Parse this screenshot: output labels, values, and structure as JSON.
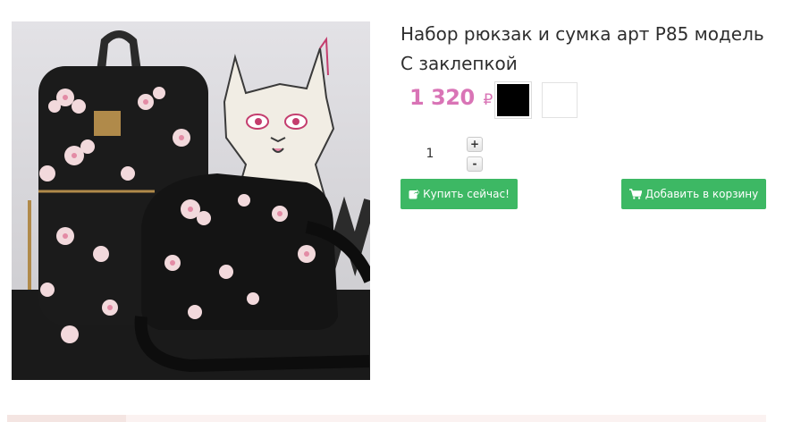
{
  "product": {
    "title": "Набор рюкзак и сумка арт Р85 модель С заклепкой",
    "image_alt": "Набор рюкзак и сумка арт Р85 модель С заклепкой",
    "price": "1 320",
    "currency": "₽",
    "swatches": [
      {
        "name": "black",
        "color": "#000000"
      },
      {
        "name": "white",
        "color": "#ffffff"
      }
    ]
  },
  "quantity": {
    "value": "1",
    "plus_label": "+",
    "minus_label": "-"
  },
  "actions": {
    "buy_now_label": "Купить сейчас!",
    "add_to_cart_label": "Добавить в корзину"
  },
  "colors": {
    "price": "#d974b6",
    "button": "#3db864",
    "strip": "#fbf2f1"
  }
}
